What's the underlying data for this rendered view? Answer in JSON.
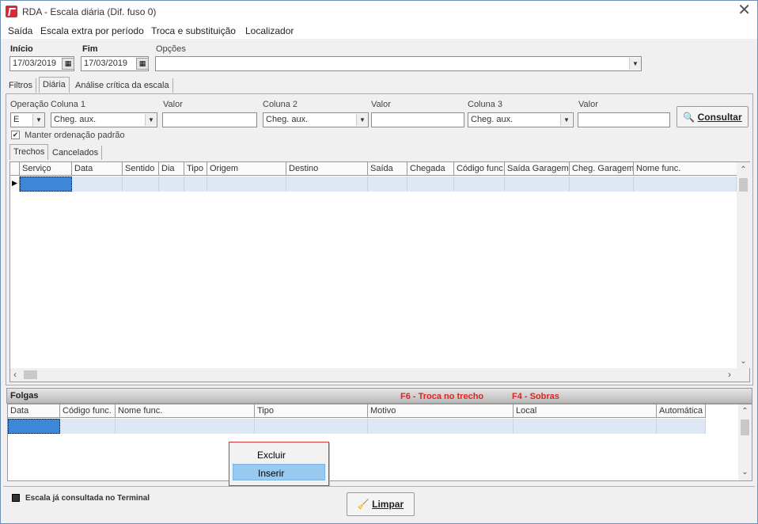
{
  "window": {
    "title": "RDA - Escala diária (Dif. fuso 0)"
  },
  "menu": [
    "Saída",
    "Escala extra por período",
    "Troca e substituição",
    "Localizador"
  ],
  "filters": {
    "inicio_label": "Início",
    "inicio_value": "17/03/2019",
    "fim_label": "Fim",
    "fim_value": "17/03/2019",
    "opcoes_label": "Opções",
    "opcoes_value": ""
  },
  "main_tabs": [
    "Filtros",
    "Diária",
    "Análise crítica da escala"
  ],
  "query": {
    "operacao_label": "Operação",
    "operacao_value": "E",
    "col1_label": "Coluna 1",
    "col1_value": "Cheg. aux.",
    "valor1_label": "Valor",
    "col2_label": "Coluna 2",
    "col2_value": "Cheg. aux.",
    "valor2_label": "Valor",
    "col3_label": "Coluna 3",
    "col3_value": "Cheg. aux.",
    "valor3_label": "Valor",
    "consultar_label": "Consultar",
    "manter_label": "Manter ordenação padrão"
  },
  "sub_tabs": [
    "Trechos",
    "Cancelados"
  ],
  "trechos_columns": [
    "Serviço",
    "Data",
    "Sentido",
    "Dia",
    "Tipo",
    "Origem",
    "Destino",
    "Saída",
    "Chegada",
    "Código func.",
    "Saída Garagem",
    "Cheg. Garagem",
    "Nome func."
  ],
  "folgas": {
    "title": "Folgas",
    "hint_f6": "F6 - Troca no trecho",
    "hint_f4": "F4 - Sobras",
    "columns": [
      "Data",
      "Código func.",
      "Nome func.",
      "Tipo",
      "Motivo",
      "Local",
      "Automática"
    ]
  },
  "context_menu": [
    "Excluir",
    "Inserir"
  ],
  "footer": {
    "status_label": "Escala já consultada no Terminal",
    "limpar_label": "Limpar"
  }
}
